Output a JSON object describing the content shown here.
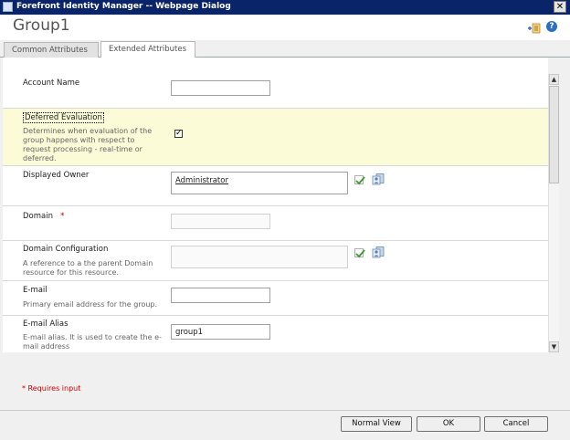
{
  "window": {
    "title": "Forefront Identity Manager -- Webpage Dialog",
    "close_glyph": "✕"
  },
  "header": {
    "title": "Group1",
    "help_glyph": "?"
  },
  "tabs": [
    {
      "label": "Common Attributes",
      "active": false
    },
    {
      "label": "Extended Attributes",
      "active": true
    }
  ],
  "form": {
    "account_name": {
      "label": "Account Name",
      "value": ""
    },
    "deferred_evaluation": {
      "label": "Deferred Evaluation",
      "description": "Determines when evaluation of the group happens with respect to request processing - real-time or deferred.",
      "checked": true,
      "check_glyph": "✓"
    },
    "displayed_owner": {
      "label": "Displayed Owner",
      "value": "Administrator"
    },
    "domain": {
      "label": "Domain",
      "required_marker": "*",
      "value": ""
    },
    "domain_configuration": {
      "label": "Domain Configuration",
      "description": "A reference to a the parent Domain resource for this resource.",
      "value": ""
    },
    "email": {
      "label": "E-mail",
      "description": "Primary email address for the group.",
      "value": ""
    },
    "email_alias": {
      "label": "E-mail Alias",
      "description": "E-mail alias. It is used to create the e-mail address",
      "value": "group1"
    }
  },
  "requires_input": "* Requires input",
  "footer": {
    "normal_view": "Normal View",
    "ok": "OK",
    "cancel": "Cancel"
  },
  "scrollbar": {
    "up_glyph": "▲",
    "down_glyph": "▼"
  },
  "icons": {
    "validate": "checkmark-icon",
    "browse": "people-browse-icon",
    "add": "add-to-list-icon",
    "help": "help-icon"
  },
  "colors": {
    "titlebar": "#0a246a",
    "highlight_row": "#fbfbd8",
    "required": "#cc0000",
    "check_green": "#3a9a2e"
  }
}
